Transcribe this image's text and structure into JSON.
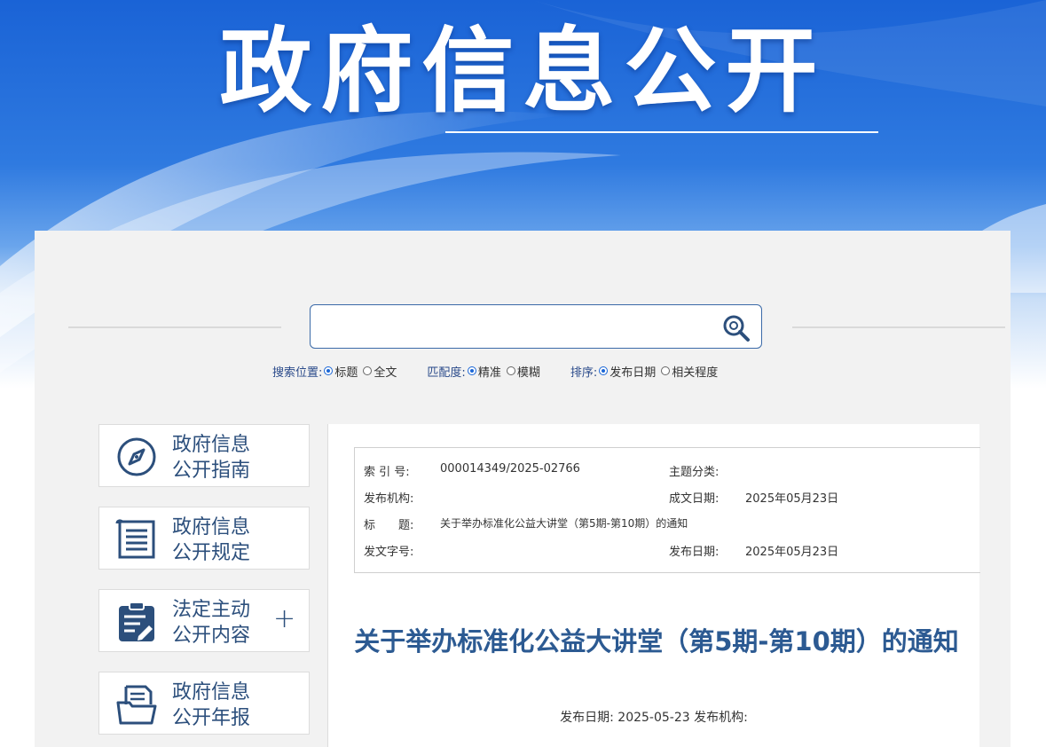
{
  "banner": {
    "title": "政府信息公开"
  },
  "search": {
    "placeholder": "",
    "position_label": "搜索位置:",
    "position_options": [
      "标题",
      "全文"
    ],
    "match_label": "匹配度:",
    "match_options": [
      "精准",
      "模糊"
    ],
    "sort_label": "排序:",
    "sort_options": [
      "发布日期",
      "相关程度"
    ]
  },
  "sidebar": {
    "items": [
      {
        "line1": "政府信息",
        "line2": "公开指南",
        "icon": "compass-icon"
      },
      {
        "line1": "政府信息",
        "line2": "公开规定",
        "icon": "list-document-icon"
      },
      {
        "line1": "法定主动",
        "line2": "公开内容",
        "icon": "clipboard-edit-icon",
        "expand": "+"
      },
      {
        "line1": "政府信息",
        "line2": "公开年报",
        "icon": "folder-document-icon"
      }
    ]
  },
  "meta": {
    "index_label": "索 引 号:",
    "index_value": "000014349/2025-02766",
    "topic_label": "主题分类:",
    "topic_value": "",
    "org_label": "发布机构:",
    "org_value": "",
    "created_label": "成文日期:",
    "created_value": "2025年05月23日",
    "title_label": "标　　题:",
    "title_value": "关于举办标准化公益大讲堂（第5期-第10期）的通知",
    "docno_label": "发文字号:",
    "docno_value": "",
    "published_label": "发布日期:",
    "published_value": "2025年05月23日"
  },
  "article": {
    "title": "关于举办标准化公益大讲堂（第5期-第10期）的通知",
    "subline": "发布日期: 2025-05-23 发布机构:"
  },
  "colors": {
    "accent": "#2c5a92",
    "banner": "#1a63d6",
    "panel": "#f2f2f2"
  }
}
